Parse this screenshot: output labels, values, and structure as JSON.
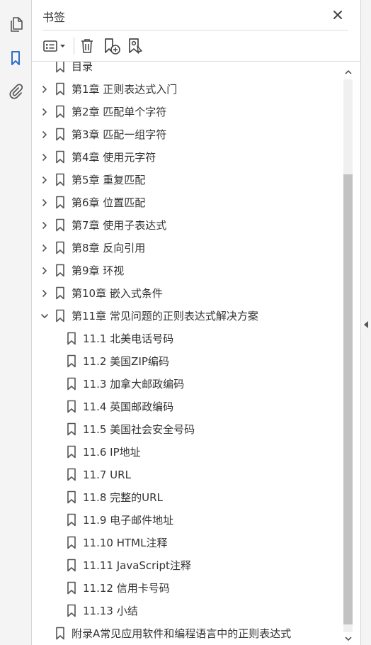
{
  "panel": {
    "title": "书签"
  },
  "colors": {
    "accent": "#2d6fc9",
    "icon": "#555555",
    "text": "#333333"
  },
  "rail": {
    "icons": [
      {
        "name": "pages-icon",
        "active": false
      },
      {
        "name": "bookmark-icon",
        "active": true
      },
      {
        "name": "attachment-icon",
        "active": false
      }
    ]
  },
  "toolbar": {
    "items": [
      "options-menu-icon",
      "delete-bookmark-icon",
      "new-bookmark-icon",
      "bookmark-from-selection-icon"
    ]
  },
  "tree": {
    "items": [
      {
        "label": "目录",
        "level": 0,
        "caret": "none"
      },
      {
        "label": "第1章  正则表达式入门",
        "level": 0,
        "caret": "collapsed"
      },
      {
        "label": "第2章  匹配单个字符",
        "level": 0,
        "caret": "collapsed"
      },
      {
        "label": "第3章  匹配一组字符",
        "level": 0,
        "caret": "collapsed"
      },
      {
        "label": "第4章  使用元字符",
        "level": 0,
        "caret": "collapsed"
      },
      {
        "label": "第5章  重复匹配",
        "level": 0,
        "caret": "collapsed"
      },
      {
        "label": "第6章  位置匹配",
        "level": 0,
        "caret": "collapsed"
      },
      {
        "label": "第7章  使用子表达式",
        "level": 0,
        "caret": "collapsed"
      },
      {
        "label": "第8章  反向引用",
        "level": 0,
        "caret": "collapsed"
      },
      {
        "label": "第9章  环视",
        "level": 0,
        "caret": "collapsed"
      },
      {
        "label": "第10章  嵌入式条件",
        "level": 0,
        "caret": "collapsed"
      },
      {
        "label": "第11章  常见问题的正则表达式解决方案",
        "level": 0,
        "caret": "expanded"
      },
      {
        "label": "11.1  北美电话号码",
        "level": 1,
        "caret": "none"
      },
      {
        "label": "11.2  美国ZIP编码",
        "level": 1,
        "caret": "none"
      },
      {
        "label": "11.3  加拿大邮政编码",
        "level": 1,
        "caret": "none"
      },
      {
        "label": "11.4  英国邮政编码",
        "level": 1,
        "caret": "none"
      },
      {
        "label": "11.5  美国社会安全号码",
        "level": 1,
        "caret": "none"
      },
      {
        "label": "11.6  IP地址",
        "level": 1,
        "caret": "none"
      },
      {
        "label": "11.7  URL",
        "level": 1,
        "caret": "none"
      },
      {
        "label": "11.8  完整的URL",
        "level": 1,
        "caret": "none"
      },
      {
        "label": "11.9  电子邮件地址",
        "level": 1,
        "caret": "none"
      },
      {
        "label": "11.10  HTML注释",
        "level": 1,
        "caret": "none"
      },
      {
        "label": "11.11  JavaScript注释",
        "level": 1,
        "caret": "none"
      },
      {
        "label": "11.12  信用卡号码",
        "level": 1,
        "caret": "none"
      },
      {
        "label": "11.13  小结",
        "level": 1,
        "caret": "none"
      },
      {
        "label": "附录A常见应用软件和编程语言中的正则表达式",
        "level": 0,
        "caret": "none"
      }
    ]
  }
}
